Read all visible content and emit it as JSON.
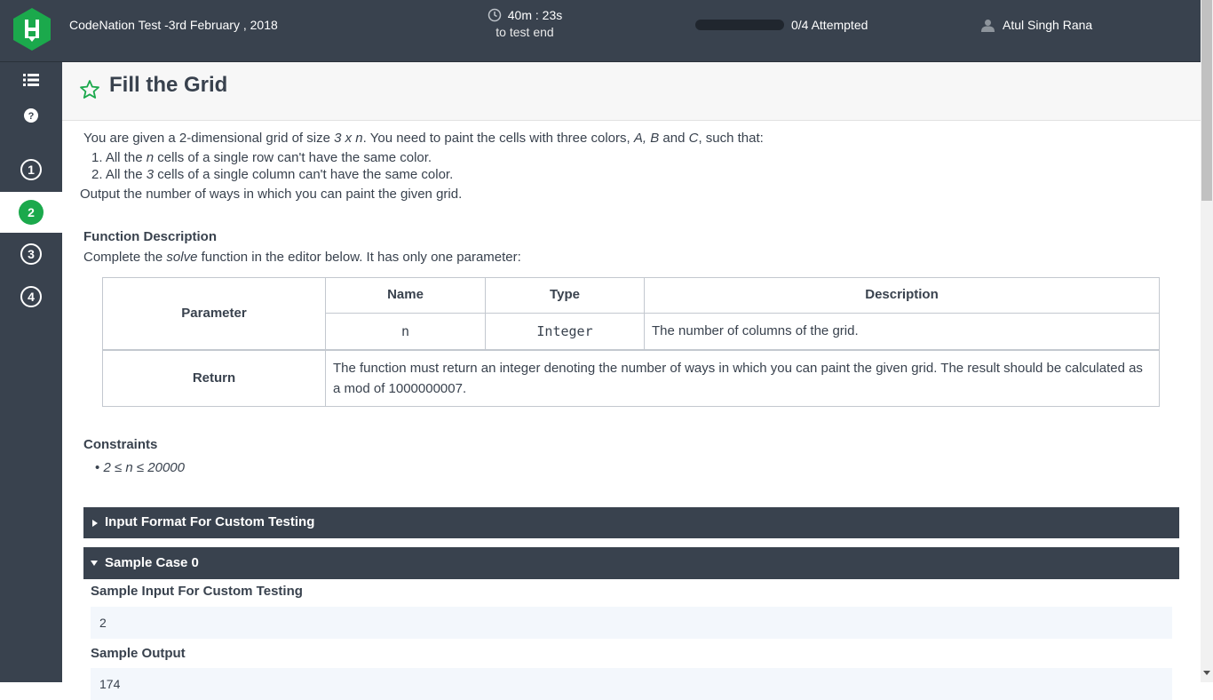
{
  "header": {
    "test_title": "CodeNation Test -3rd February , 2018",
    "timer_value": "40m : 23s",
    "timer_label": "to test end",
    "progress_label": "0/4 Attempted",
    "progress_fraction": 0,
    "user_name": "Atul Singh Rana"
  },
  "sidebar": {
    "questions": [
      "1",
      "2",
      "3",
      "4"
    ],
    "active_question": "2"
  },
  "problem": {
    "title": "Fill the Grid",
    "intro_1": "You are given a 2-dimensional grid of size ",
    "intro_grid": "3 x n",
    "intro_2": ". You need to paint the cells with three colors, ",
    "intro_colors": "A, B",
    "intro_3": " and ",
    "intro_c": "C",
    "intro_4": ", such that:",
    "rule1_a": "1. All the ",
    "rule1_n": "n",
    "rule1_b": " cells of a single row can't have the same color.",
    "rule2_a": "2. All the ",
    "rule2_n": "3",
    "rule2_b": " cells of a single column can't have the same color.",
    "output_line": "Output the number of ways in which you can paint the given grid.",
    "function_heading": "Function Description",
    "function_text_a": "Complete the ",
    "function_name": "solve",
    "function_text_b": " function in the editor below. It has only one parameter:",
    "table": {
      "parameter_label": "Parameter",
      "col_name": "Name",
      "col_type": "Type",
      "col_description": "Description",
      "param_name": "n",
      "param_type": "Integer",
      "param_description": "The number of columns of the grid.",
      "return_label": "Return",
      "return_text": "The function must return an integer denoting the number of ways in which you can paint the given grid. The result should be calculated as a mod of 1000000007."
    },
    "constraints_heading": "Constraints",
    "constraint_1": "2 ≤ n ≤ 20000",
    "accordion_input": "Input Format For Custom Testing",
    "accordion_sample": "Sample Case 0",
    "sample_input_heading": "Sample Input For Custom Testing",
    "sample_input_value": "2",
    "sample_output_heading": "Sample Output",
    "sample_output_value": "174"
  },
  "colors": {
    "topbar": "#39424e",
    "accent_green": "#1ba94c",
    "sample_bg": "#f3f7fc"
  },
  "icons": {
    "logo": "hackerrank-logo-icon",
    "clock": "clock-icon",
    "user": "user-icon",
    "list": "list-icon",
    "help": "help-icon",
    "star": "star-icon"
  }
}
